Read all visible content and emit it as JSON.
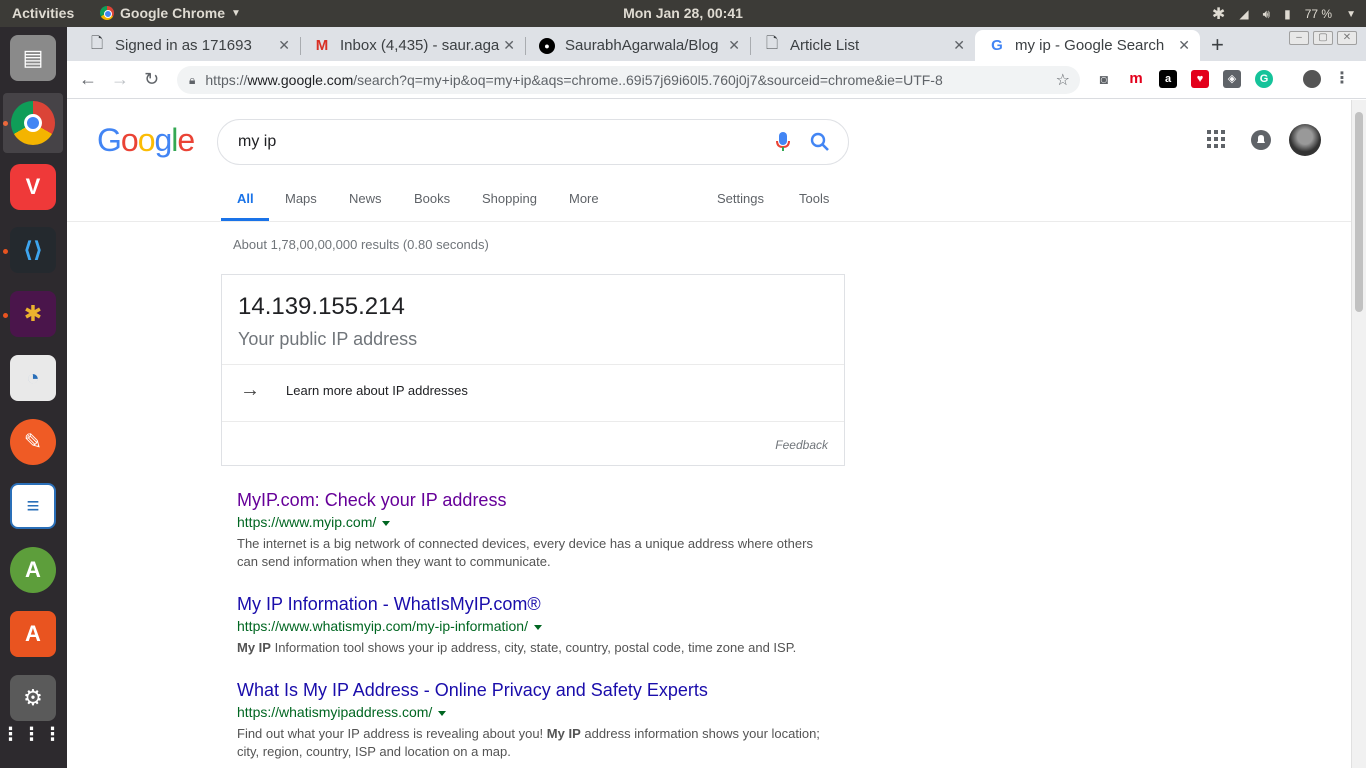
{
  "topbar": {
    "activities": "Activities",
    "app_name": "Google Chrome",
    "clock": "Mon Jan 28, 00:41",
    "battery": "77 %"
  },
  "dock": {
    "items": [
      "files",
      "chrome",
      "vivaldi",
      "vscode",
      "slack",
      "libreoffice-draw",
      "postman",
      "libreoffice-writer",
      "android-studio",
      "ubuntu-software",
      "settings",
      "show-apps"
    ]
  },
  "tabs": [
    {
      "title": "Signed in as 171693",
      "favicon": "page-icon"
    },
    {
      "title": "Inbox (4,435) - saur.agar",
      "favicon": "gmail-icon"
    },
    {
      "title": "SaurabhAgarwala/Blog",
      "favicon": "github-icon"
    },
    {
      "title": "Article List",
      "favicon": "page-icon"
    },
    {
      "title": "my ip - Google Search",
      "favicon": "google-icon"
    }
  ],
  "omnibox": {
    "scheme": "https://",
    "host": "www.google.com",
    "path": "/search?q=my+ip&oq=my+ip&aqs=chrome..69i57j69i60l5.760j0j7&sourceid=chrome&ie=UTF-8"
  },
  "search": {
    "query": "my ip"
  },
  "nav_tabs": [
    "All",
    "Maps",
    "News",
    "Books",
    "Shopping",
    "More",
    "Settings",
    "Tools"
  ],
  "stats": "About 1,78,00,00,000 results (0.80 seconds)",
  "ip_card": {
    "ip": "14.139.155.214",
    "label": "Your public IP address",
    "learn_more": "Learn more about IP addresses",
    "feedback": "Feedback"
  },
  "results": [
    {
      "title": "MyIP.com: Check your IP address",
      "url": "https://www.myip.com/",
      "snippet": "The internet is a big network of connected devices, every device has a unique address where others can send information when they want to communicate."
    },
    {
      "title": "My IP Information - WhatIsMyIP.com®",
      "url": "https://www.whatismyip.com/my-ip-information/",
      "snippet_bold": "My IP",
      "snippet": " Information tool shows your ip address, city, state, country, postal code, time zone and ISP."
    },
    {
      "title": "What Is My IP Address - Online Privacy and Safety Experts",
      "url": "https://whatismyipaddress.com/",
      "snippet_a": "Find out what your IP address is revealing about you! ",
      "snippet_bold": "My IP",
      "snippet_b": " address information shows your location; city, region, country, ISP and location on a map."
    }
  ],
  "colors": {
    "link_visited": "#660099",
    "link": "#1a0dab",
    "url_green": "#006621",
    "accent_blue": "#1a73e8"
  }
}
